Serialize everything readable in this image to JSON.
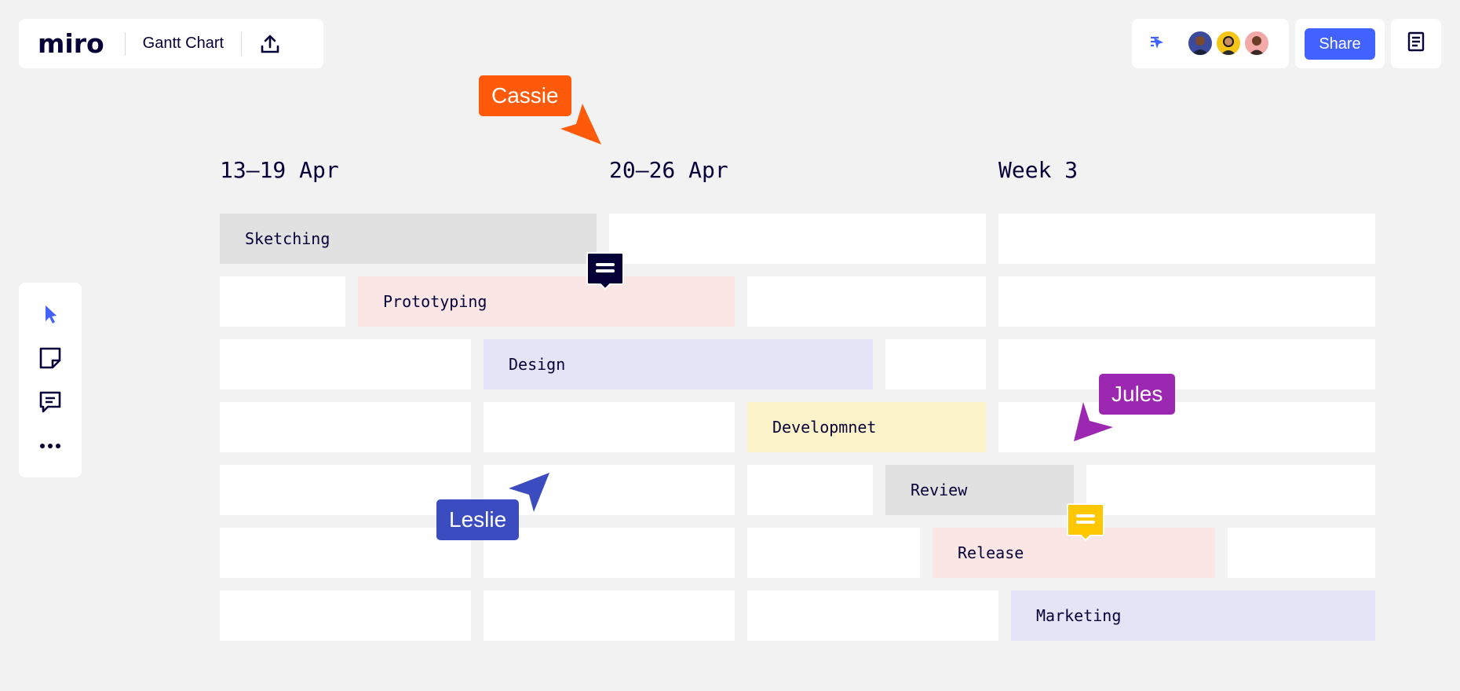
{
  "header": {
    "logo": "miro",
    "board_title": "Gantt Chart",
    "share_label": "Share",
    "icons": {
      "export": "upload-icon",
      "follow": "follow-cursor-icon",
      "notes": "notes-icon"
    }
  },
  "toolbar": {
    "tools": [
      "select-cursor-icon",
      "sticky-note-icon",
      "comment-icon",
      "more-icon"
    ]
  },
  "gantt": {
    "weeks": [
      "13–19 Apr",
      "20–26 Apr",
      "Week 3"
    ],
    "tasks": [
      "Sketching",
      "Prototyping",
      "Design",
      "Developmnet",
      "Review",
      "Release",
      "Marketing"
    ]
  },
  "cursors": {
    "cassie": "Cassie",
    "jules": "Jules",
    "leslie": "Leslie"
  },
  "colors": {
    "accent": "#4262ff",
    "cassie": "#ff5a0a",
    "jules": "#9c27b0",
    "leslie": "#3a4cbf",
    "sketching": "#e1e1e1",
    "prototyping": "#fbe6e6",
    "design": "#e3e5f7",
    "development": "#fdf3c9",
    "review": "#e1e1e1",
    "release": "#fbe6e6",
    "marketing": "#e3e5f7"
  }
}
